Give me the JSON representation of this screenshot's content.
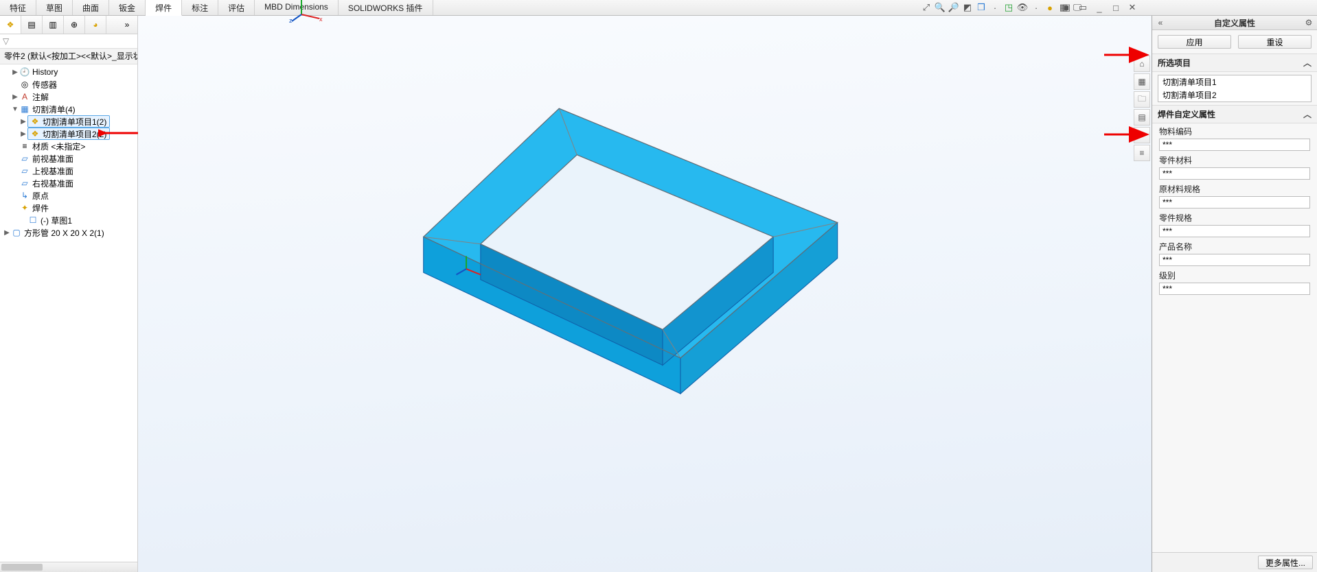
{
  "tabs": {
    "t0": "特征",
    "t1": "草图",
    "t2": "曲面",
    "t3": "钣金",
    "t4": "焊件",
    "t5": "标注",
    "t6": "评估",
    "t7": "MBD Dimensions",
    "t8": "SOLIDWORKS 插件"
  },
  "partHeader": "零件2 (默认<按加工><<默认>_显示状",
  "tree": {
    "history": "History",
    "sensor": "传感器",
    "annot": "注解",
    "cutlist": "切割清单(4)",
    "cutitem1": "切割清单项目1(2)",
    "cutitem2": "切割清单项目2(2)",
    "material": "材质 <未指定>",
    "front": "前视基准面",
    "top": "上视基准面",
    "right": "右视基准面",
    "origin": "原点",
    "weldment": "焊件",
    "sketch": "(-) 草图1",
    "tube": "方形管 20 X 20 X 2(1)"
  },
  "rightPanel": {
    "title": "自定义属性",
    "apply": "应用",
    "reset": "重设",
    "selSection": "所选项目",
    "selItems": {
      "i1": "切割清单项目1",
      "i2": "切割清单项目2"
    },
    "propSection": "焊件自定义属性",
    "props": {
      "p1l": "物料编码",
      "p1v": "***",
      "p2l": "零件材料",
      "p2v": "***",
      "p3l": "原材料规格",
      "p3v": "***",
      "p4l": "零件规格",
      "p4v": "***",
      "p5l": "产品名称",
      "p5v": "***",
      "p6l": "级别",
      "p6v": "***"
    },
    "more": "更多属性..."
  },
  "icons": {
    "filter": "▽",
    "arrowR": "▶",
    "arrowD": "▼",
    "caretUp": "︿",
    "gear": "⚙",
    "chevL": "«",
    "chevR": "»",
    "doc": "📄",
    "folder": "🗀",
    "cube": "◧",
    "sensor": "◎",
    "note": "A",
    "mat": "≡",
    "plane": "▱",
    "origin": "↳",
    "weld": "✦",
    "sketch": "☐",
    "tube": "▢"
  }
}
